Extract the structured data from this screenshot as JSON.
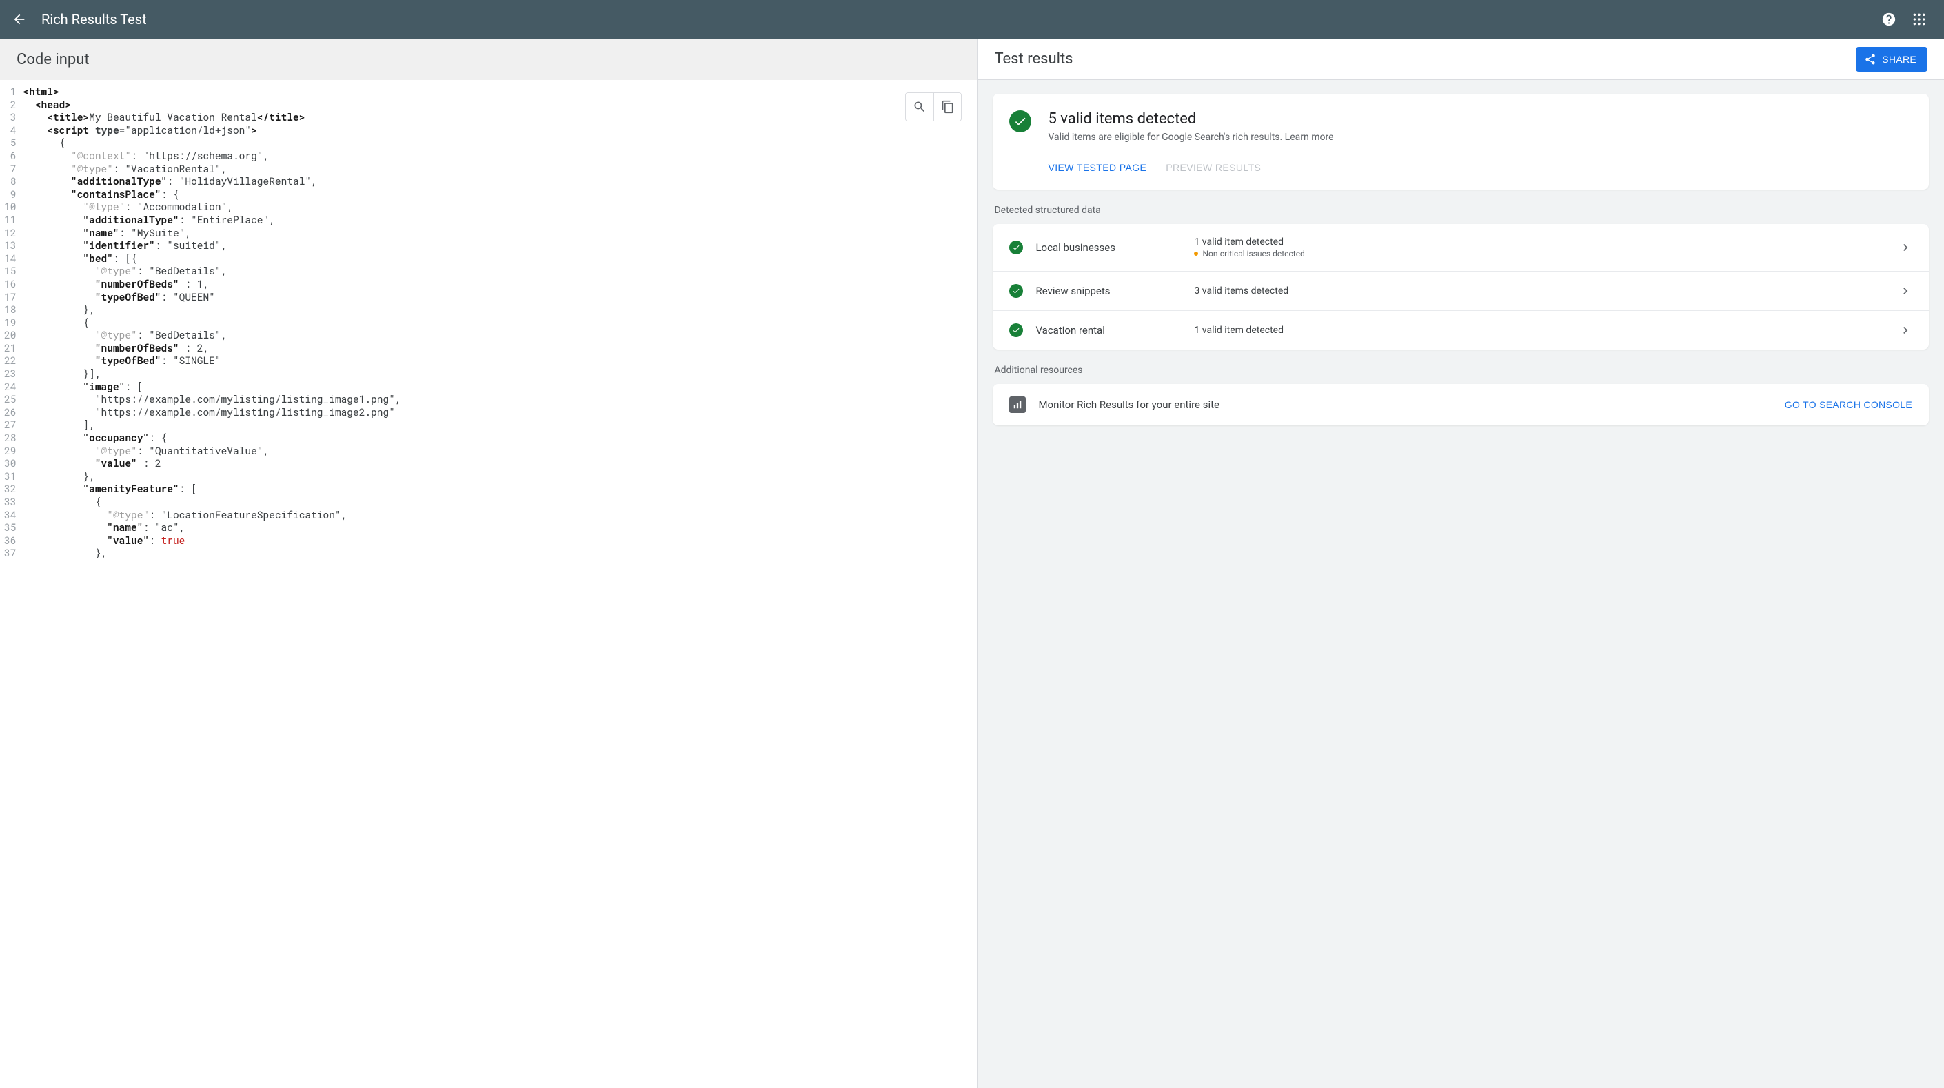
{
  "header": {
    "title": "Rich Results Test"
  },
  "left": {
    "title": "Code input"
  },
  "right": {
    "title": "Test results",
    "share": "SHARE",
    "summary": {
      "heading": "5 valid items detected",
      "sub": "Valid items are eligible for Google Search's rich results. ",
      "learn": "Learn more",
      "view": "VIEW TESTED PAGE",
      "preview": "PREVIEW RESULTS"
    },
    "detected_label": "Detected structured data",
    "rows": [
      {
        "name": "Local businesses",
        "status": "1 valid item detected",
        "sub": "Non-critical issues detected",
        "has_sub": true
      },
      {
        "name": "Review snippets",
        "status": "3 valid items detected",
        "has_sub": false
      },
      {
        "name": "Vacation rental",
        "status": "1 valid item detected",
        "has_sub": false
      }
    ],
    "additional_label": "Additional resources",
    "resource": {
      "text": "Monitor Rich Results for your entire site",
      "btn": "GO TO SEARCH CONSOLE"
    }
  },
  "code": {
    "lines": [
      {
        "n": 1,
        "seg": [
          [
            "tag",
            "<html>"
          ]
        ]
      },
      {
        "n": 2,
        "seg": [
          [
            "plain",
            "  "
          ],
          [
            "tag",
            "<head>"
          ]
        ]
      },
      {
        "n": 3,
        "seg": [
          [
            "plain",
            "    "
          ],
          [
            "tag",
            "<title>"
          ],
          [
            "plain",
            "My Beautiful Vacation Rental"
          ],
          [
            "tag",
            "</title>"
          ]
        ]
      },
      {
        "n": 4,
        "seg": [
          [
            "plain",
            "    "
          ],
          [
            "tag",
            "<script "
          ],
          [
            "attr",
            "type"
          ],
          [
            "plain",
            "="
          ],
          [
            "str",
            "\"application/ld+json\""
          ],
          [
            "tag",
            ">"
          ]
        ]
      },
      {
        "n": 5,
        "seg": [
          [
            "plain",
            "      {"
          ]
        ]
      },
      {
        "n": 6,
        "seg": [
          [
            "plain",
            "        "
          ],
          [
            "grey",
            "\"@context\""
          ],
          [
            "plain",
            ": "
          ],
          [
            "str",
            "\"https://schema.org\""
          ],
          [
            "plain",
            ","
          ]
        ]
      },
      {
        "n": 7,
        "seg": [
          [
            "plain",
            "        "
          ],
          [
            "grey",
            "\"@type\""
          ],
          [
            "plain",
            ": "
          ],
          [
            "str",
            "\"VacationRental\""
          ],
          [
            "plain",
            ","
          ]
        ]
      },
      {
        "n": 8,
        "seg": [
          [
            "plain",
            "        "
          ],
          [
            "key",
            "\"additionalType\""
          ],
          [
            "plain",
            ": "
          ],
          [
            "str",
            "\"HolidayVillageRental\""
          ],
          [
            "plain",
            ","
          ]
        ]
      },
      {
        "n": 9,
        "seg": [
          [
            "plain",
            "        "
          ],
          [
            "key",
            "\"containsPlace\""
          ],
          [
            "plain",
            ": {"
          ]
        ]
      },
      {
        "n": 10,
        "seg": [
          [
            "plain",
            "          "
          ],
          [
            "grey",
            "\"@type\""
          ],
          [
            "plain",
            ": "
          ],
          [
            "str",
            "\"Accommodation\""
          ],
          [
            "plain",
            ","
          ]
        ]
      },
      {
        "n": 11,
        "seg": [
          [
            "plain",
            "          "
          ],
          [
            "key",
            "\"additionalType\""
          ],
          [
            "plain",
            ": "
          ],
          [
            "str",
            "\"EntirePlace\""
          ],
          [
            "plain",
            ","
          ]
        ]
      },
      {
        "n": 12,
        "seg": [
          [
            "plain",
            "          "
          ],
          [
            "key",
            "\"name\""
          ],
          [
            "plain",
            ": "
          ],
          [
            "str",
            "\"MySuite\""
          ],
          [
            "plain",
            ","
          ]
        ]
      },
      {
        "n": 13,
        "seg": [
          [
            "plain",
            "          "
          ],
          [
            "key",
            "\"identifier\""
          ],
          [
            "plain",
            ": "
          ],
          [
            "str",
            "\"suiteid\""
          ],
          [
            "plain",
            ","
          ]
        ]
      },
      {
        "n": 14,
        "seg": [
          [
            "plain",
            "          "
          ],
          [
            "key",
            "\"bed\""
          ],
          [
            "plain",
            ": [{"
          ]
        ]
      },
      {
        "n": 15,
        "seg": [
          [
            "plain",
            "            "
          ],
          [
            "grey",
            "\"@type\""
          ],
          [
            "plain",
            ": "
          ],
          [
            "str",
            "\"BedDetails\""
          ],
          [
            "plain",
            ","
          ]
        ]
      },
      {
        "n": 16,
        "seg": [
          [
            "plain",
            "            "
          ],
          [
            "key",
            "\"numberOfBeds\""
          ],
          [
            "plain",
            " : 1,"
          ]
        ]
      },
      {
        "n": 17,
        "seg": [
          [
            "plain",
            "            "
          ],
          [
            "key",
            "\"typeOfBed\""
          ],
          [
            "plain",
            ": "
          ],
          [
            "str",
            "\"QUEEN\""
          ]
        ]
      },
      {
        "n": 18,
        "seg": [
          [
            "plain",
            "          },"
          ]
        ]
      },
      {
        "n": 19,
        "seg": [
          [
            "plain",
            "          {"
          ]
        ]
      },
      {
        "n": 20,
        "seg": [
          [
            "plain",
            "            "
          ],
          [
            "grey",
            "\"@type\""
          ],
          [
            "plain",
            ": "
          ],
          [
            "str",
            "\"BedDetails\""
          ],
          [
            "plain",
            ","
          ]
        ]
      },
      {
        "n": 21,
        "seg": [
          [
            "plain",
            "            "
          ],
          [
            "key",
            "\"numberOfBeds\""
          ],
          [
            "plain",
            " : 2,"
          ]
        ]
      },
      {
        "n": 22,
        "seg": [
          [
            "plain",
            "            "
          ],
          [
            "key",
            "\"typeOfBed\""
          ],
          [
            "plain",
            ": "
          ],
          [
            "str",
            "\"SINGLE\""
          ]
        ]
      },
      {
        "n": 23,
        "seg": [
          [
            "plain",
            "          }],"
          ]
        ]
      },
      {
        "n": 24,
        "seg": [
          [
            "plain",
            "          "
          ],
          [
            "key",
            "\"image\""
          ],
          [
            "plain",
            ": ["
          ]
        ]
      },
      {
        "n": 25,
        "seg": [
          [
            "plain",
            "            "
          ],
          [
            "str",
            "\"https://example.com/mylisting/listing_image1.png\""
          ],
          [
            "plain",
            ","
          ]
        ]
      },
      {
        "n": 26,
        "seg": [
          [
            "plain",
            "            "
          ],
          [
            "str",
            "\"https://example.com/mylisting/listing_image2.png\""
          ]
        ]
      },
      {
        "n": 27,
        "seg": [
          [
            "plain",
            "          ],"
          ]
        ]
      },
      {
        "n": 28,
        "seg": [
          [
            "plain",
            "          "
          ],
          [
            "key",
            "\"occupancy\""
          ],
          [
            "plain",
            ": {"
          ]
        ]
      },
      {
        "n": 29,
        "seg": [
          [
            "plain",
            "            "
          ],
          [
            "grey",
            "\"@type\""
          ],
          [
            "plain",
            ": "
          ],
          [
            "str",
            "\"QuantitativeValue\""
          ],
          [
            "plain",
            ","
          ]
        ]
      },
      {
        "n": 30,
        "seg": [
          [
            "plain",
            "            "
          ],
          [
            "key",
            "\"value\""
          ],
          [
            "plain",
            " : 2"
          ]
        ]
      },
      {
        "n": 31,
        "seg": [
          [
            "plain",
            "          },"
          ]
        ]
      },
      {
        "n": 32,
        "seg": [
          [
            "plain",
            "          "
          ],
          [
            "key",
            "\"amenityFeature\""
          ],
          [
            "plain",
            ": ["
          ]
        ]
      },
      {
        "n": 33,
        "seg": [
          [
            "plain",
            "            {"
          ]
        ]
      },
      {
        "n": 34,
        "seg": [
          [
            "plain",
            "              "
          ],
          [
            "grey",
            "\"@type\""
          ],
          [
            "plain",
            ": "
          ],
          [
            "str",
            "\"LocationFeatureSpecification\""
          ],
          [
            "plain",
            ","
          ]
        ]
      },
      {
        "n": 35,
        "seg": [
          [
            "plain",
            "              "
          ],
          [
            "key",
            "\"name\""
          ],
          [
            "plain",
            ": "
          ],
          [
            "str",
            "\"ac\""
          ],
          [
            "plain",
            ","
          ]
        ]
      },
      {
        "n": 36,
        "seg": [
          [
            "plain",
            "              "
          ],
          [
            "key",
            "\"value\""
          ],
          [
            "plain",
            ": "
          ],
          [
            "bool",
            "true"
          ]
        ]
      },
      {
        "n": 37,
        "seg": [
          [
            "plain",
            "            },"
          ]
        ]
      }
    ]
  }
}
